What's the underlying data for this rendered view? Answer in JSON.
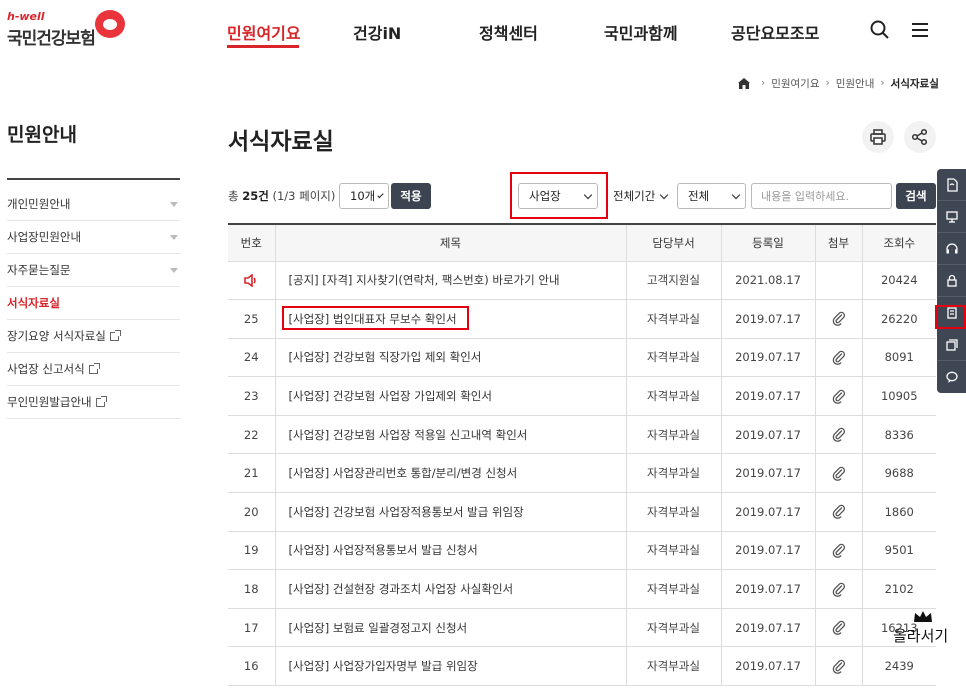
{
  "logo": {
    "sub": "h-well",
    "main": "국민건강보험"
  },
  "gnb": {
    "items": [
      "민원여기요",
      "건강iN",
      "정책센터",
      "국민과함께",
      "공단요모조모"
    ]
  },
  "breadcrumb": {
    "items": [
      "민원여기요",
      "민원안내",
      "서식자료실"
    ]
  },
  "sidebar": {
    "title": "민원안내",
    "items": [
      {
        "label": "개인민원안내"
      },
      {
        "label": "사업장민원안내"
      },
      {
        "label": "자주묻는질문"
      },
      {
        "label": "서식자료실"
      },
      {
        "label": "장기요양 서식자료실"
      },
      {
        "label": "사업장 신고서식"
      },
      {
        "label": "무인민원발급안내"
      }
    ]
  },
  "page": {
    "title": "서식자료실"
  },
  "toolbar": {
    "total_prefix": "총 ",
    "total_count": "25건",
    "total_pages": " (1/3 페이지)",
    "page_size": "10개",
    "apply_label": "적용",
    "category": "사업장",
    "period": "전체기간",
    "field": "전체",
    "search_placeholder": "내용을 입력하세요.",
    "search_label": "검색"
  },
  "table": {
    "headers": [
      "번호",
      "제목",
      "담당부서",
      "등록일",
      "첨부",
      "조회수"
    ],
    "rows": [
      {
        "no": "",
        "title": "[공지] [자격] 지사찾기(연락처, 팩스번호) 바로가기 안내",
        "dept": "고객지원실",
        "date": "2021.08.17",
        "attach": false,
        "views": "20424"
      },
      {
        "no": "25",
        "title": "[사업장] 법인대표자 무보수 확인서",
        "dept": "자격부과실",
        "date": "2019.07.17",
        "attach": true,
        "views": "26220"
      },
      {
        "no": "24",
        "title": "[사업장] 건강보험 직장가입 제외 확인서",
        "dept": "자격부과실",
        "date": "2019.07.17",
        "attach": true,
        "views": "8091"
      },
      {
        "no": "23",
        "title": "[사업장] 건강보험 사업장 가입제외 확인서",
        "dept": "자격부과실",
        "date": "2019.07.17",
        "attach": true,
        "views": "10905"
      },
      {
        "no": "22",
        "title": "[사업장] 건강보험 사업장 적용일 신고내역 확인서",
        "dept": "자격부과실",
        "date": "2019.07.17",
        "attach": true,
        "views": "8336"
      },
      {
        "no": "21",
        "title": "[사업장] 사업장관리번호 통합/분리/변경 신청서",
        "dept": "자격부과실",
        "date": "2019.07.17",
        "attach": true,
        "views": "9688"
      },
      {
        "no": "20",
        "title": "[사업장] 건강보험 사업장적용통보서 발급 위임장",
        "dept": "자격부과실",
        "date": "2019.07.17",
        "attach": true,
        "views": "1860"
      },
      {
        "no": "19",
        "title": "[사업장] 사업장적용통보서 발급 신청서",
        "dept": "자격부과실",
        "date": "2019.07.17",
        "attach": true,
        "views": "9501"
      },
      {
        "no": "18",
        "title": "[사업장] 건설현장 경과조치 사업장 사실확인서",
        "dept": "자격부과실",
        "date": "2019.07.17",
        "attach": true,
        "views": "2102"
      },
      {
        "no": "17",
        "title": "[사업장] 보험료 일괄경정고지 신청서",
        "dept": "자격부과실",
        "date": "2019.07.17",
        "attach": true,
        "views": "16213"
      },
      {
        "no": "16",
        "title": "[사업장] 사업장가입자명부 발급 위임장",
        "dept": "자격부과실",
        "date": "2019.07.17",
        "attach": true,
        "views": "2439"
      }
    ]
  },
  "top_button": {
    "label": "올라서기"
  },
  "colors": {
    "accent": "#d9252a",
    "dark": "#3d4451",
    "highlight": "#e4000f"
  },
  "icons": [
    "search-icon",
    "menu-icon",
    "home-icon",
    "print-icon",
    "share-icon",
    "speaker-icon",
    "paperclip-icon",
    "crown-icon"
  ]
}
